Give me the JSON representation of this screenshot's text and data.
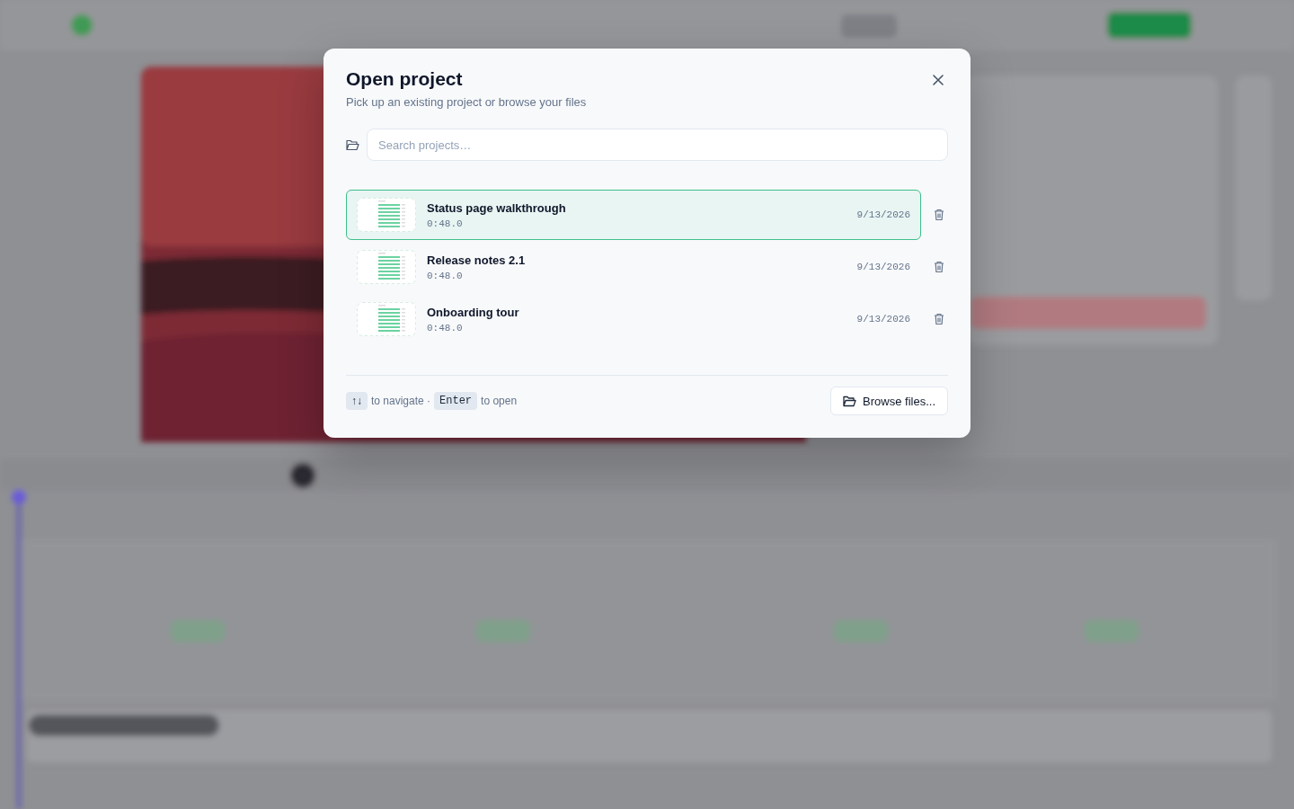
{
  "dialog": {
    "title": "Open project",
    "subtitle": "Pick up an existing project or browse your files",
    "search": {
      "placeholder": "Search projects…"
    },
    "projects": [
      {
        "name": "Status page walkthrough",
        "duration": "0:48.0",
        "date": "9/13/2026",
        "selected": true
      },
      {
        "name": "Release notes 2.1",
        "duration": "0:48.0",
        "date": "9/13/2026",
        "selected": false
      },
      {
        "name": "Onboarding tour",
        "duration": "0:48.0",
        "date": "9/13/2026",
        "selected": false
      }
    ],
    "footer": {
      "nav_key": "↑↓",
      "nav_hint": "to navigate ·",
      "open_key": "Enter",
      "open_hint": "to open",
      "browse_button": "Browse files..."
    }
  }
}
